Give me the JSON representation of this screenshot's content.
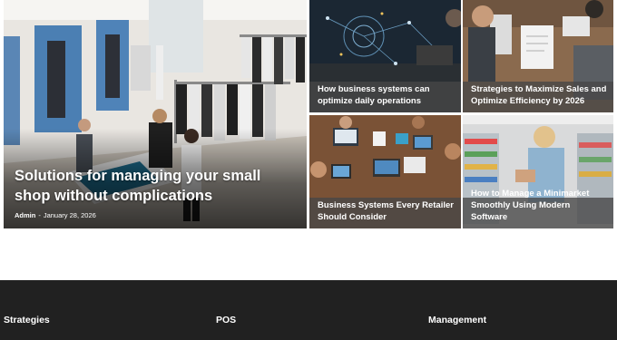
{
  "posts": {
    "featured": {
      "title": "Solutions for managing your small shop without complications",
      "author": "Admin",
      "separator": "-",
      "date": "January 28, 2026"
    },
    "items": [
      {
        "title": "How business systems can optimize daily operations"
      },
      {
        "title": "Strategies to Maximize Sales and Optimize Efficiency by 2026"
      },
      {
        "title": "Business Systems Every Retailer Should Consider"
      },
      {
        "title": "How to Manage a Minimarket Smoothly Using Modern Software"
      }
    ]
  },
  "footer": {
    "columns": [
      "Strategies",
      "POS",
      "Management"
    ]
  },
  "colors": {
    "footer_bg": "#212121",
    "overlay_bar": "#464646",
    "text": "#ffffff"
  }
}
